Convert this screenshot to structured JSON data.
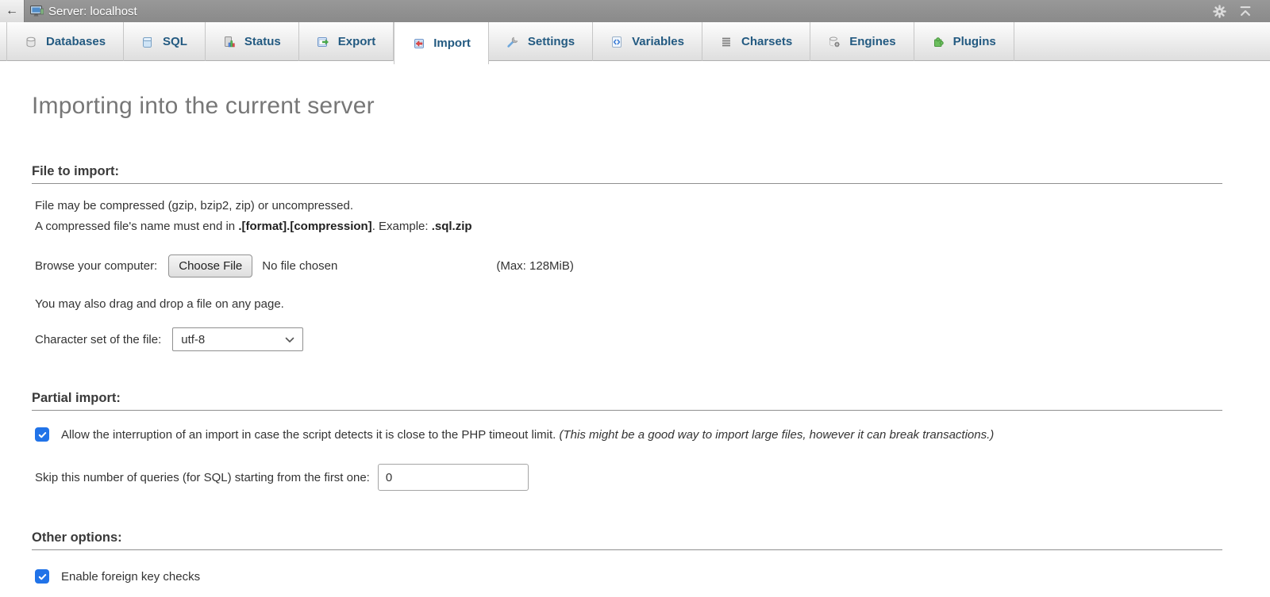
{
  "titlebar": {
    "server_label": "Server: localhost"
  },
  "topnav": {
    "tabs": [
      {
        "label": "Databases",
        "icon": "databases-icon",
        "active": false
      },
      {
        "label": "SQL",
        "icon": "sql-icon",
        "active": false
      },
      {
        "label": "Status",
        "icon": "status-icon",
        "active": false
      },
      {
        "label": "Export",
        "icon": "export-icon",
        "active": false
      },
      {
        "label": "Import",
        "icon": "import-icon",
        "active": true
      },
      {
        "label": "Settings",
        "icon": "settings-icon",
        "active": false
      },
      {
        "label": "Variables",
        "icon": "variables-icon",
        "active": false
      },
      {
        "label": "Charsets",
        "icon": "charsets-icon",
        "active": false
      },
      {
        "label": "Engines",
        "icon": "engines-icon",
        "active": false
      },
      {
        "label": "Plugins",
        "icon": "plugins-icon",
        "active": false
      }
    ]
  },
  "page": {
    "title": "Importing into the current server"
  },
  "file_to_import": {
    "heading": "File to import:",
    "line1": "File may be compressed (gzip, bzip2, zip) or uncompressed.",
    "line2_prefix": "A compressed file's name must end in ",
    "line2_bold1": ".[format].[compression]",
    "line2_mid": ". Example: ",
    "line2_bold2": ".sql.zip",
    "browse_label": "Browse your computer:",
    "choose_file_button": "Choose File",
    "no_file_text": "No file chosen",
    "max_size": "(Max: 128MiB)",
    "drag_drop_note": "You may also drag and drop a file on any page.",
    "charset_label": "Character set of the file:",
    "charset_value": "utf-8"
  },
  "partial_import": {
    "heading": "Partial import:",
    "interrupt_checkbox_checked": true,
    "interrupt_label": "Allow the interruption of an import in case the script detects it is close to the PHP timeout limit.",
    "interrupt_note": "(This might be a good way to import large files, however it can break transactions.)",
    "skip_label": "Skip this number of queries (for SQL) starting from the first one:",
    "skip_value": "0"
  },
  "other_options": {
    "heading": "Other options:",
    "fk_checkbox_checked": true,
    "fk_label": "Enable foreign key checks"
  },
  "colors": {
    "titlebar_gray": "#8f8f8f",
    "tab_text_blue": "#235a81",
    "checkbox_blue": "#2173e8",
    "heading_gray": "#777777"
  }
}
